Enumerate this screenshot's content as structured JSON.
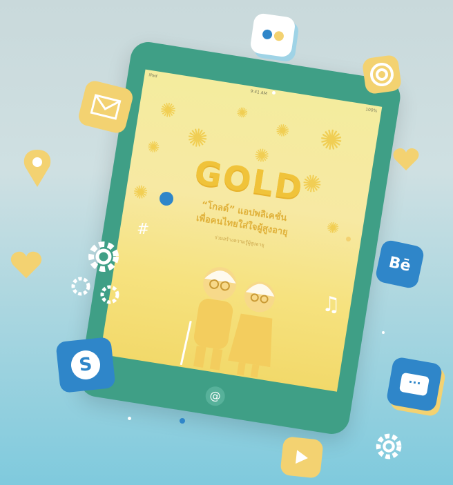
{
  "app": {
    "title": "GOLD",
    "subtitle_line1": "“โกลด์” แอปพลิเคชั่น",
    "subtitle_line2": "เพื่อคนไทยใส่ใจผู้สูงอายุ",
    "byline": "ร่วมสร้างความรู้ผู้สูงอายุ",
    "status_left": "iPad",
    "status_center": "9:41 AM",
    "status_right": "100%"
  },
  "icons": {
    "flickr": "flickr-icon",
    "target": "target-icon",
    "mail": "mail-icon",
    "pin": "location-pin-icon",
    "heart_right": "heart-icon",
    "heart_left": "heart-icon",
    "behance": "behance-icon",
    "skype": "skype-icon",
    "chat": "chat-icon",
    "play": "play-icon",
    "at": "at-icon",
    "music": "music-note-icon",
    "hashtag": "hashtag-icon",
    "gears": "gear-icon"
  },
  "labels": {
    "behance": "Bē",
    "skype": "S",
    "home": "@",
    "hashtag": "#",
    "chat": "···"
  },
  "colors": {
    "tablet": "#3f9f86",
    "screen": "#f5e79a",
    "gold": "#f0c33a",
    "blue_icon": "#2f86c9",
    "yellow_icon": "#f3d271"
  }
}
